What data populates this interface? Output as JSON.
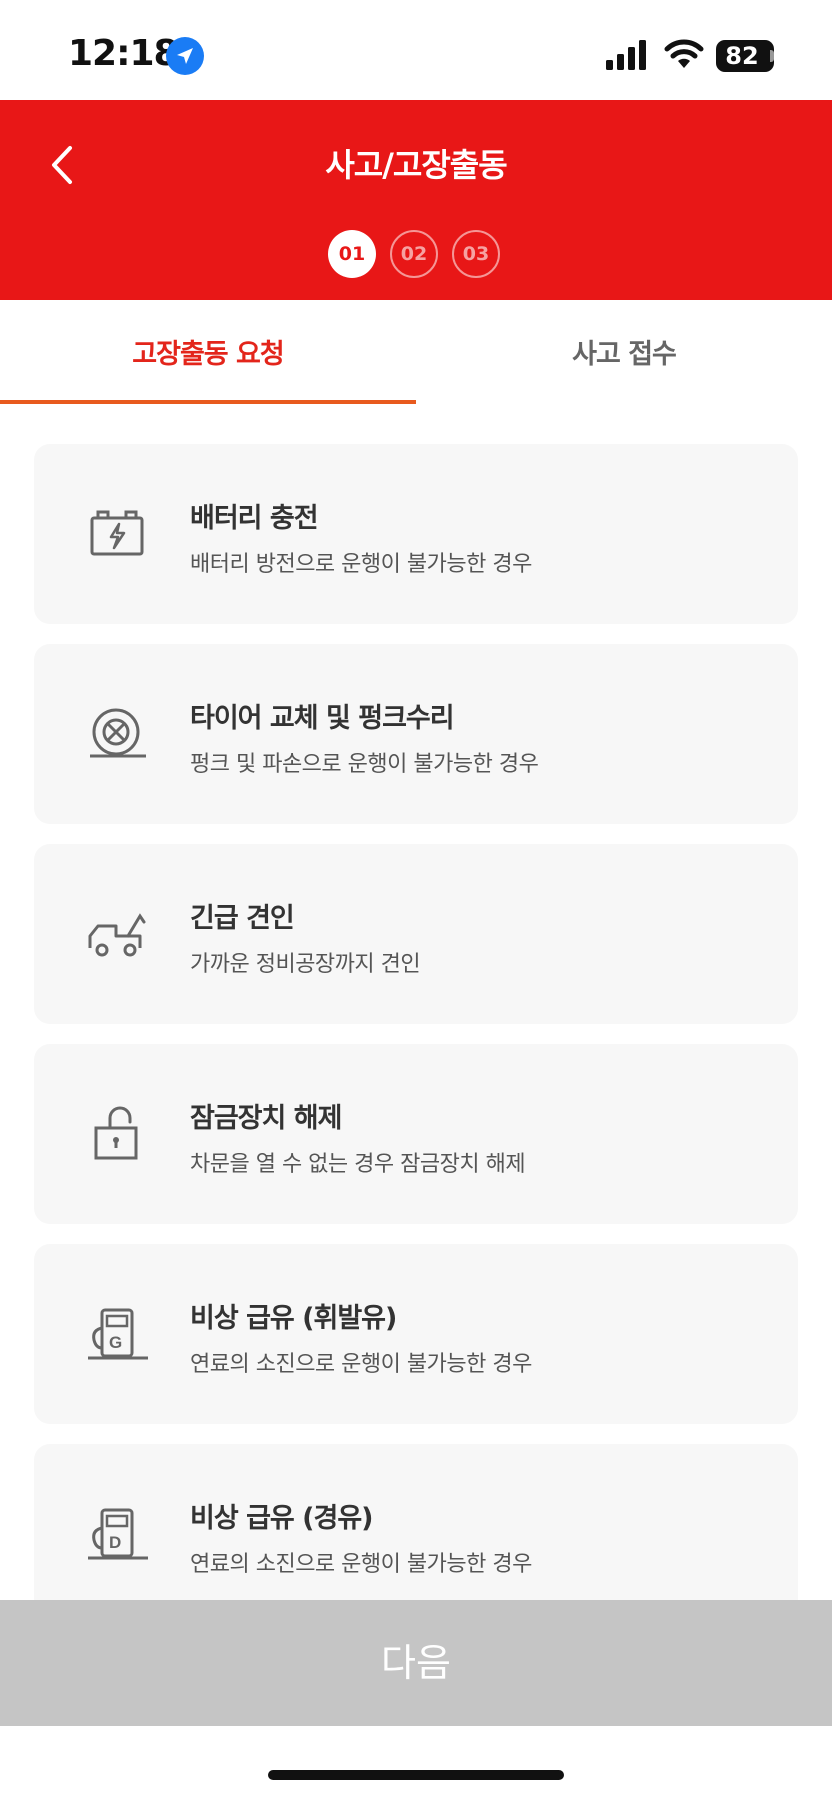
{
  "status_bar": {
    "time": "12:18",
    "battery": "82"
  },
  "header": {
    "title": "사고/고장출동",
    "steps": [
      "01",
      "02",
      "03"
    ]
  },
  "tabs": [
    {
      "label": "고장출동 요청"
    },
    {
      "label": "사고 접수"
    }
  ],
  "services": [
    {
      "icon": "battery-icon",
      "title": "배터리 충전",
      "desc": "배터리 방전으로 운행이 불가능한 경우"
    },
    {
      "icon": "tire-icon",
      "title": "타이어 교체 및 펑크수리",
      "desc": "펑크 및 파손으로 운행이 불가능한 경우"
    },
    {
      "icon": "tow-truck-icon",
      "title": "긴급 견인",
      "desc": "가까운 정비공장까지 견인"
    },
    {
      "icon": "unlock-icon",
      "title": "잠금장치 해제",
      "desc": "차문을 열 수 없는 경우 잠금장치 해제"
    },
    {
      "icon": "gasoline-pump-icon",
      "title": "비상 급유 (휘발유)",
      "desc": "연료의 소진으로 운행이 불가능한 경우"
    },
    {
      "icon": "diesel-pump-icon",
      "title": "비상 급유 (경유)",
      "desc": "연료의 소진으로 운행이 불가능한 경우"
    }
  ],
  "next_button": "다음",
  "colors": {
    "header": "#e81717",
    "tab_active": "#e3251b",
    "tab_underline": "#e85a1e",
    "card_bg": "#f7f7f7",
    "button_disabled": "#c5c5c5"
  }
}
